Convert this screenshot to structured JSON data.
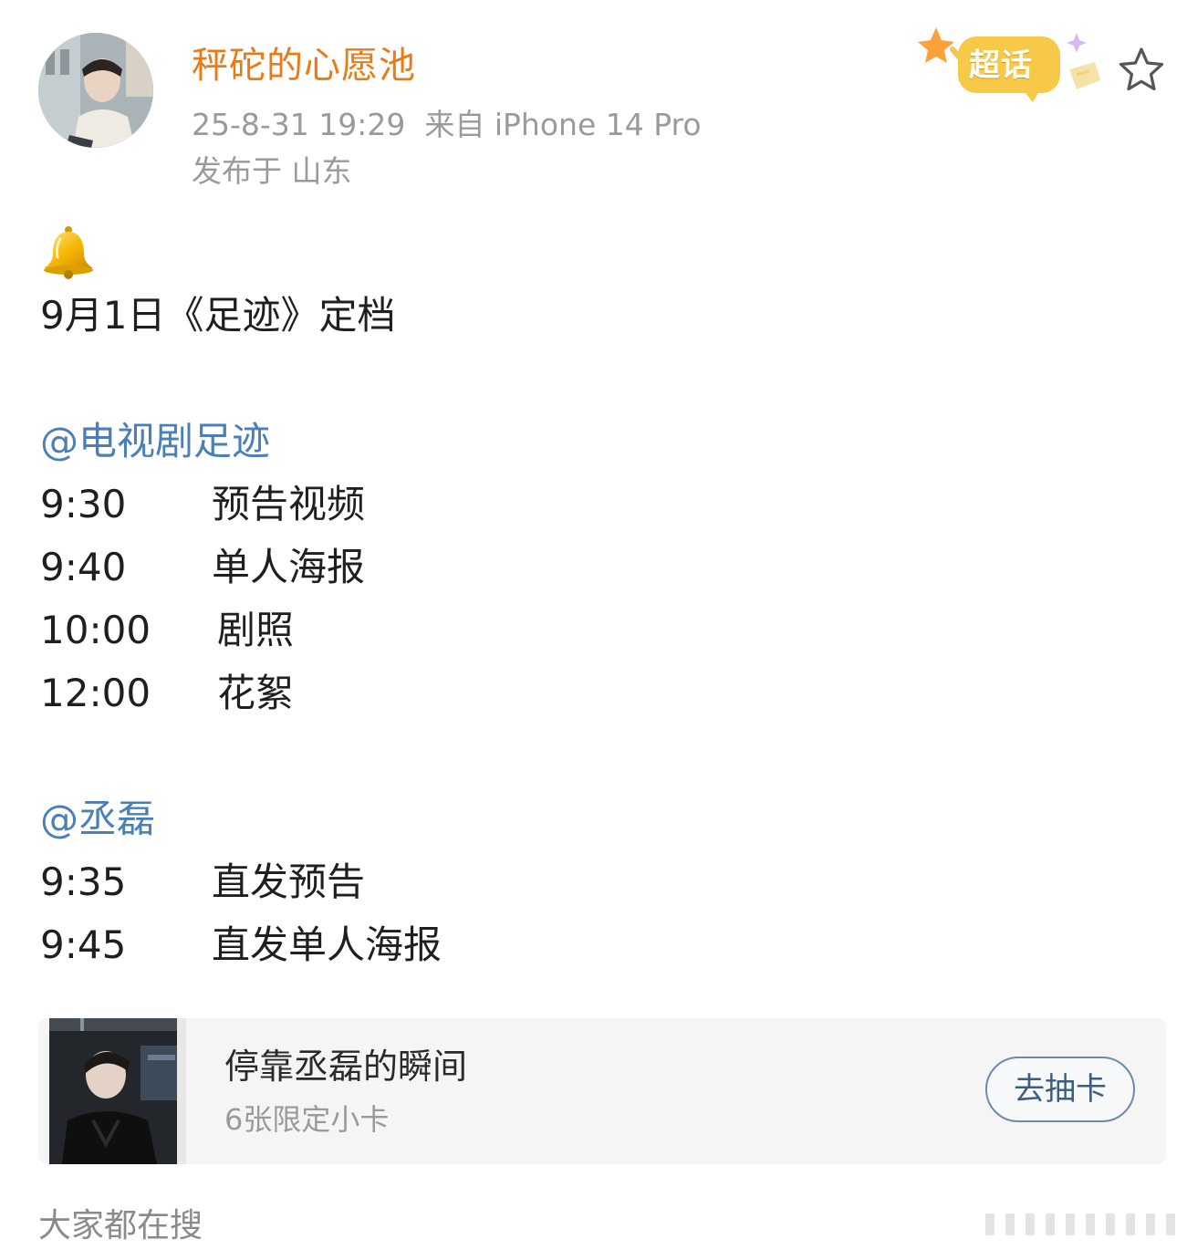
{
  "post": {
    "username": "秤砣的心愿池",
    "timestamp": "25-8-31 19:29",
    "source": "来自 iPhone 14 Pro",
    "location": "发布于 山东",
    "supertopic_badge": "超话",
    "favorite_icon": "star-outline-icon",
    "emoji": "bell-icon",
    "headline": "9月1日《足迹》定档",
    "sections": [
      {
        "mention": "@电视剧足迹",
        "schedule": [
          {
            "time": "9:30",
            "label": "预告视频"
          },
          {
            "time": "9:40",
            "label": "单人海报"
          },
          {
            "time": "10:00",
            "label": "剧照"
          },
          {
            "time": "12:00",
            "label": "花絮"
          }
        ]
      },
      {
        "mention": "@丞磊",
        "schedule": [
          {
            "time": "9:35",
            "label": "直发预告"
          },
          {
            "time": "9:45",
            "label": "直发单人海报"
          }
        ]
      }
    ]
  },
  "card": {
    "title": "停靠丞磊的瞬间",
    "subtitle": "6张限定小卡",
    "button_label": "去抽卡"
  },
  "footer": {
    "search_label": "大家都在搜"
  },
  "colors": {
    "username": "#eb7a15",
    "mention": "#4a7fb8",
    "meta": "#9a9a9a",
    "badge": "#f7c948"
  }
}
